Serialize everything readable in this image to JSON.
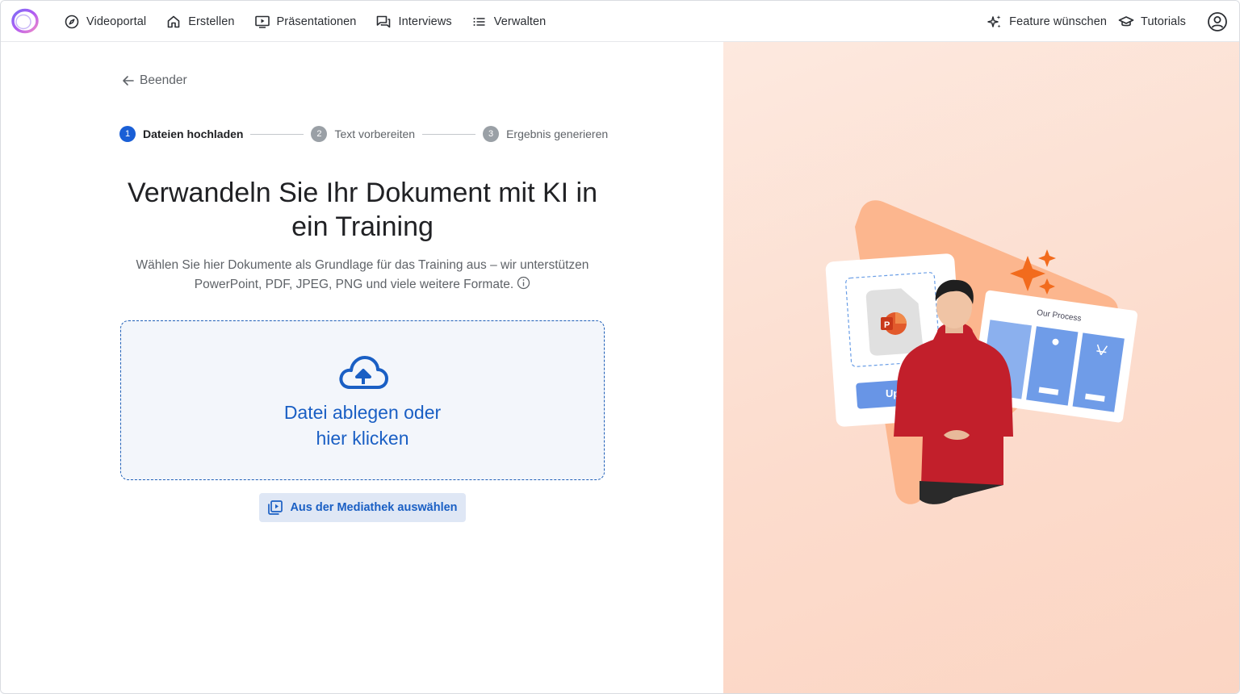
{
  "nav": {
    "items": [
      {
        "label": "Videoportal",
        "icon": "compass-icon"
      },
      {
        "label": "Erstellen",
        "icon": "home-icon"
      },
      {
        "label": "Präsentationen",
        "icon": "presentation-icon"
      },
      {
        "label": "Interviews",
        "icon": "chat-icon"
      },
      {
        "label": "Verwalten",
        "icon": "list-icon"
      }
    ],
    "right": {
      "feature": "Feature wünschen",
      "tutorials": "Tutorials"
    }
  },
  "back_label": "Beender",
  "stepper": [
    {
      "num": "1",
      "label": "Dateien hochladen",
      "active": true
    },
    {
      "num": "2",
      "label": "Text vorbereiten",
      "active": false
    },
    {
      "num": "3",
      "label": "Ergebnis generieren",
      "active": false
    }
  ],
  "headline": "Verwandeln Sie Ihr Dokument mit KI in ein Training",
  "description": "Wählen Sie hier Dokumente als Grundlage für das Training aus – wir unterstützen PowerPoint, PDF, JPEG, PNG und viele weitere Formate.",
  "dropzone": {
    "line1": "Datei ablegen oder",
    "line2": "hier klicken"
  },
  "media_button": "Aus der Mediathek auswählen",
  "illustration": {
    "card_title": "Our Process",
    "upload_label": "Upl"
  },
  "colors": {
    "primary": "#1a5fd6",
    "dropzone_bg": "#f3f6fb",
    "panel_bg": "#fde3d6",
    "accent_orange": "#f26b1d"
  }
}
